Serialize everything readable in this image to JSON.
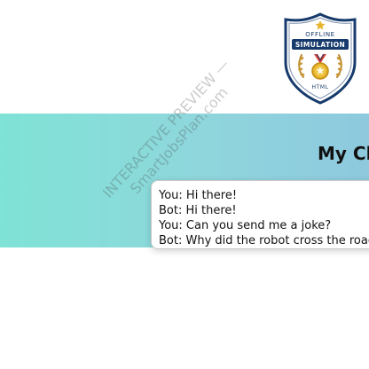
{
  "header": {
    "title": "My Cha"
  },
  "chat": {
    "messages": [
      {
        "text": "You: Hi there!"
      },
      {
        "text": "Bot: Hi there!"
      },
      {
        "text": "You: Can you send me a joke?"
      },
      {
        "text": "Bot: Why did the robot cross the road? Beca"
      }
    ]
  },
  "badge": {
    "top": "OFFLINE",
    "main": "SIMULATION",
    "bottom": "HTML"
  },
  "watermark": {
    "line1": "INTERACTIVE PREVIEW —",
    "line2": "SmartJobsPlan.com"
  },
  "colors": {
    "badge_blue": "#173b6c",
    "medal_gold": "#e7b52c",
    "ribbon_red": "#e0433a"
  }
}
